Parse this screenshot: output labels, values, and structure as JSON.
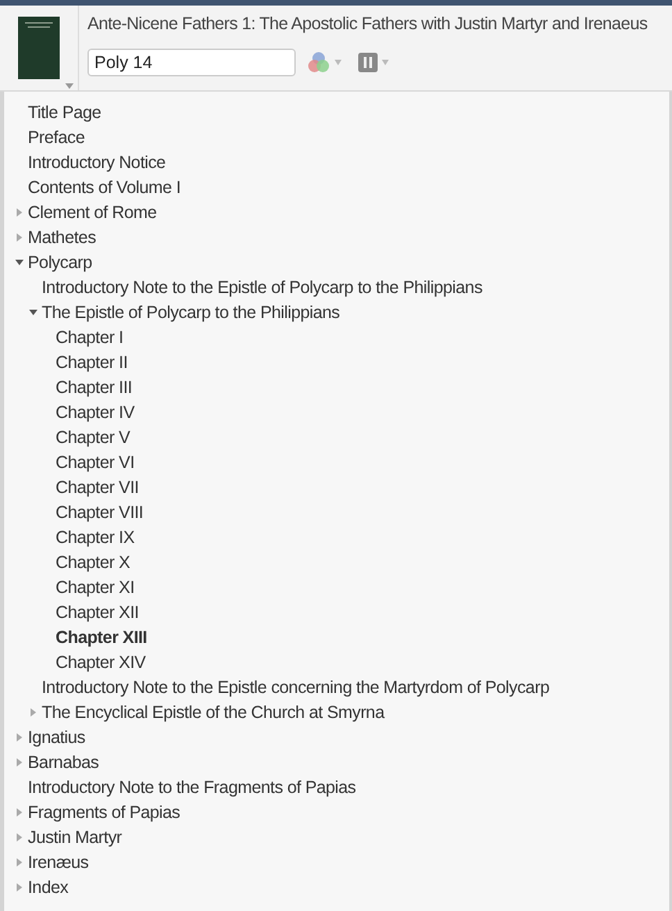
{
  "book": {
    "title": "Ante-Nicene Fathers 1: The Apostolic Fathers with Justin Martyr and Irenaeus",
    "reference": {
      "value": "Poly 14"
    }
  },
  "toc": [
    {
      "label": "Title Page",
      "kind": "leaf",
      "selected": false
    },
    {
      "label": "Preface",
      "kind": "leaf",
      "selected": false
    },
    {
      "label": "Introductory Notice",
      "kind": "leaf",
      "selected": false
    },
    {
      "label": "Contents of Volume I",
      "kind": "leaf",
      "selected": false
    },
    {
      "label": "Clement of Rome",
      "kind": "branch",
      "expanded": false,
      "selected": false
    },
    {
      "label": "Mathetes",
      "kind": "branch",
      "expanded": false,
      "selected": false
    },
    {
      "label": "Polycarp",
      "kind": "branch",
      "expanded": true,
      "selected": false,
      "children": [
        {
          "label": "Introductory Note to the Epistle of Polycarp to the Philippians",
          "kind": "leaf",
          "selected": false
        },
        {
          "label": "The Epistle of Polycarp to the Philippians",
          "kind": "branch",
          "expanded": true,
          "selected": false,
          "children": [
            {
              "label": "Chapter I",
              "kind": "leaf",
              "selected": false
            },
            {
              "label": "Chapter II",
              "kind": "leaf",
              "selected": false
            },
            {
              "label": "Chapter III",
              "kind": "leaf",
              "selected": false
            },
            {
              "label": "Chapter IV",
              "kind": "leaf",
              "selected": false
            },
            {
              "label": "Chapter V",
              "kind": "leaf",
              "selected": false
            },
            {
              "label": "Chapter VI",
              "kind": "leaf",
              "selected": false
            },
            {
              "label": "Chapter VII",
              "kind": "leaf",
              "selected": false
            },
            {
              "label": "Chapter VIII",
              "kind": "leaf",
              "selected": false
            },
            {
              "label": "Chapter IX",
              "kind": "leaf",
              "selected": false
            },
            {
              "label": "Chapter X",
              "kind": "leaf",
              "selected": false
            },
            {
              "label": "Chapter XI",
              "kind": "leaf",
              "selected": false
            },
            {
              "label": "Chapter XII",
              "kind": "leaf",
              "selected": false
            },
            {
              "label": "Chapter XIII",
              "kind": "leaf",
              "selected": true
            },
            {
              "label": "Chapter XIV",
              "kind": "leaf",
              "selected": false
            }
          ]
        },
        {
          "label": "Introductory Note to the Epistle concerning the Martyrdom of Polycarp",
          "kind": "leaf",
          "selected": false
        },
        {
          "label": "The Encyclical Epistle of the Church at Smyrna",
          "kind": "branch",
          "expanded": false,
          "selected": false
        }
      ]
    },
    {
      "label": "Ignatius",
      "kind": "branch",
      "expanded": false,
      "selected": false
    },
    {
      "label": "Barnabas",
      "kind": "branch",
      "expanded": false,
      "selected": false
    },
    {
      "label": "Introductory Note to the Fragments of Papias",
      "kind": "leaf",
      "selected": false
    },
    {
      "label": "Fragments of Papias",
      "kind": "branch",
      "expanded": false,
      "selected": false
    },
    {
      "label": "Justin Martyr",
      "kind": "branch",
      "expanded": false,
      "selected": false
    },
    {
      "label": "Irenæus",
      "kind": "branch",
      "expanded": false,
      "selected": false
    },
    {
      "label": "Index",
      "kind": "branch",
      "expanded": false,
      "selected": false
    }
  ]
}
